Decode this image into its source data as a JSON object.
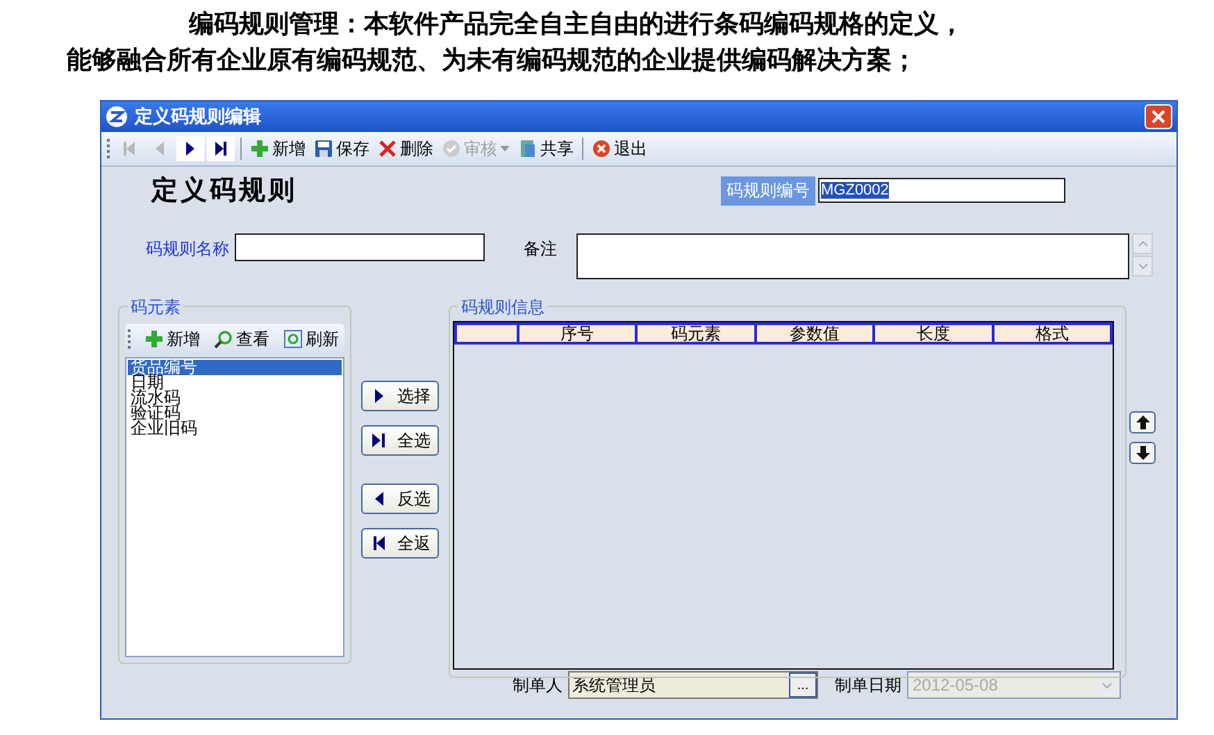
{
  "slide": {
    "lines": [
      "**编码规则管理**：本软件产品完全自主自由的进行条码编码规格的定义，",
      "能够融合所有企业原有编码规范、为未有编码规范的企业提供编码解决方案；"
    ]
  },
  "window": {
    "title": "定义码规则编辑"
  },
  "toolbar": [
    {
      "kind": "nav-first",
      "disabled": true
    },
    {
      "kind": "nav-prev",
      "disabled": true
    },
    {
      "kind": "nav-next",
      "disabled": false
    },
    {
      "kind": "nav-last",
      "disabled": false
    },
    {
      "kind": "separator"
    },
    {
      "kind": "add",
      "label": "新增",
      "disabled": false
    },
    {
      "kind": "save",
      "label": "保存",
      "disabled": false
    },
    {
      "kind": "delete",
      "label": "删除",
      "disabled": false
    },
    {
      "kind": "audit",
      "label": "审核",
      "disabled": true,
      "dropdown": true
    },
    {
      "kind": "share",
      "label": "共享",
      "disabled": false
    },
    {
      "kind": "separator"
    },
    {
      "kind": "exit",
      "label": "退出",
      "disabled": false
    }
  ],
  "form": {
    "heading": "定义码规则",
    "code_label": "码规则编号",
    "code_value": "MGZ0002",
    "code_value_selected": true,
    "name_label": "码规则名称",
    "remarks_label": "备注"
  },
  "elements_panel": {
    "title": "码元素",
    "toolbar": [
      {
        "kind": "add",
        "label": "新增"
      },
      {
        "kind": "view",
        "label": "查看"
      },
      {
        "kind": "refresh",
        "label": "刷新"
      }
    ],
    "items": [
      {
        "label": "货品编号",
        "selected": true
      },
      {
        "label": "日期",
        "selected": false
      },
      {
        "label": "流水码",
        "selected": false
      },
      {
        "label": "验证码",
        "selected": false
      },
      {
        "label": "企业旧码",
        "selected": false
      }
    ]
  },
  "transfer_buttons": [
    {
      "kind": "select",
      "label": "选择"
    },
    {
      "kind": "select-all",
      "label": "全选"
    },
    {
      "kind": "deselect",
      "label": "反选"
    },
    {
      "kind": "return-all",
      "label": "全返"
    }
  ],
  "rules_panel": {
    "title": "码规则信息",
    "columns": [
      "序号",
      "码元素",
      "参数值",
      "长度",
      "格式"
    ]
  },
  "order_buttons": [
    {
      "kind": "up"
    },
    {
      "kind": "down"
    }
  ],
  "footer": {
    "creator_label": "制单人",
    "creator_value": "系统管理员",
    "browse_label": "...",
    "date_label": "制单日期",
    "date_value": "2012-05-08",
    "date_disabled": true
  }
}
